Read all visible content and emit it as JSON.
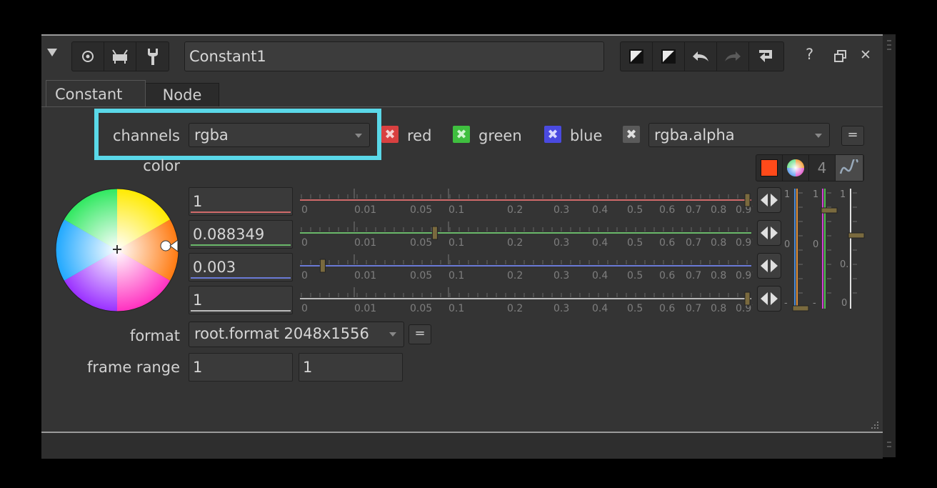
{
  "node_name": "Constant1",
  "tabs": [
    {
      "label": "Constant",
      "active": true
    },
    {
      "label": "Node",
      "active": false
    }
  ],
  "channels": {
    "label": "channels",
    "value": "rgba",
    "checks": [
      {
        "label": "red",
        "color": "#d84040"
      },
      {
        "label": "green",
        "color": "#3fbf3f"
      },
      {
        "label": "blue",
        "color": "#4a4ae0"
      }
    ],
    "extra_check_color": "#5a5a5a",
    "alpha_value": "rgba.alpha",
    "link_button": "="
  },
  "color": {
    "label": "color",
    "tool_number": "4",
    "swatch_color": "#ff4a1a",
    "values": [
      "1",
      "0.088349",
      "0.003",
      "1"
    ],
    "slider_ticks": [
      "0",
      "0.01",
      "0.05",
      "0.1",
      "0.2",
      "0.3",
      "0.4",
      "0.5",
      "0.6",
      "0.7",
      "0.8",
      "0.91"
    ],
    "slider_colors": [
      "#d06a6a",
      "#6ab86a",
      "#6a7ad6",
      "#bbbbbb"
    ],
    "slider_positions": [
      1.0,
      0.3,
      0.05,
      1.0
    ],
    "vertical_labels": {
      "col1": [
        "1",
        "0",
        "-"
      ],
      "col2": [
        "1",
        "0",
        "-"
      ],
      "col3": [
        "1",
        "0.",
        "0"
      ]
    }
  },
  "format": {
    "label": "format",
    "value": "root.format 2048x1556",
    "link_button": "="
  },
  "frame_range": {
    "label": "frame range",
    "start": "1",
    "end": "1"
  },
  "title_icons": [
    "render-icon",
    "viewer-icon",
    "wrench-icon",
    "swatch-icon",
    "swatch-icon",
    "undo-icon",
    "redo-icon",
    "revert-icon",
    "help-icon",
    "float-icon",
    "close-icon"
  ],
  "window_controls": {
    "help": "?",
    "close": "✕"
  }
}
